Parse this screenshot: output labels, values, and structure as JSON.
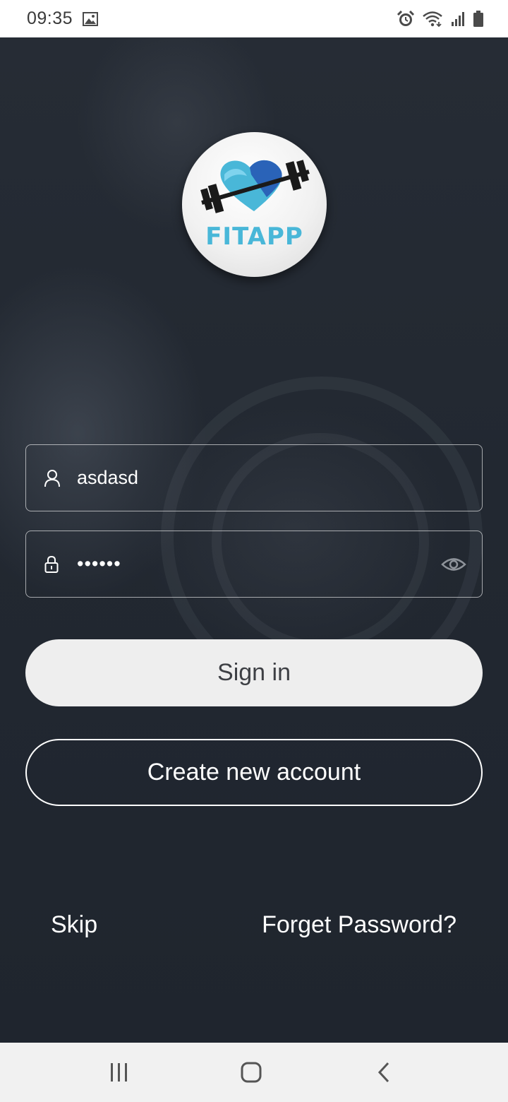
{
  "status_bar": {
    "time": "09:35",
    "icons": [
      "gallery-icon",
      "alarm-icon",
      "wifi-icon",
      "signal-icon",
      "battery-icon"
    ]
  },
  "logo": {
    "text": "FITAPP",
    "colors": {
      "heart_light": "#49b7d8",
      "heart_dark": "#2a63b8",
      "bar": "#1a1a1a"
    }
  },
  "login_form": {
    "username": {
      "value": "asdasd",
      "icon": "user-icon"
    },
    "password": {
      "value": "asdasd",
      "icon": "lock-icon",
      "toggle_icon": "eye-icon"
    }
  },
  "buttons": {
    "sign_in": "Sign in",
    "create_account": "Create new account"
  },
  "links": {
    "skip": "Skip",
    "forget_password": "Forget Password?"
  },
  "nav_bar": {
    "icons": [
      "recent-apps-icon",
      "home-icon",
      "back-icon"
    ]
  }
}
